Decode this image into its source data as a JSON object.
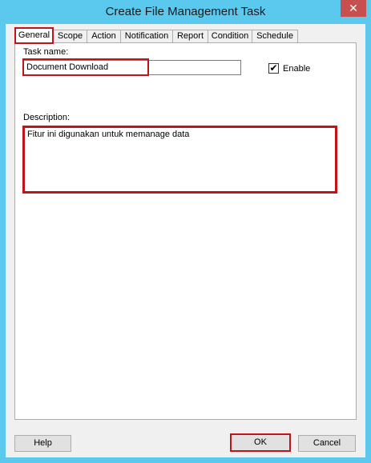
{
  "window": {
    "title": "Create File Management Task",
    "close_glyph": "✕"
  },
  "tabs": [
    {
      "label": "General",
      "active": true
    },
    {
      "label": "Scope"
    },
    {
      "label": "Action"
    },
    {
      "label": "Notification"
    },
    {
      "label": "Report"
    },
    {
      "label": "Condition"
    },
    {
      "label": "Schedule"
    }
  ],
  "general": {
    "task_name_label": "Task name:",
    "task_name_value": "Document Download",
    "enable_label": "Enable",
    "enable_checked": true,
    "check_glyph": "✔",
    "description_label": "Description:",
    "description_value": "Fitur ini digunakan untuk memanage data"
  },
  "buttons": {
    "help": "Help",
    "ok": "OK",
    "cancel": "Cancel"
  },
  "colors": {
    "titlebar": "#5bc8ee",
    "highlight": "#c0141a",
    "close_button": "#c74f4f"
  }
}
